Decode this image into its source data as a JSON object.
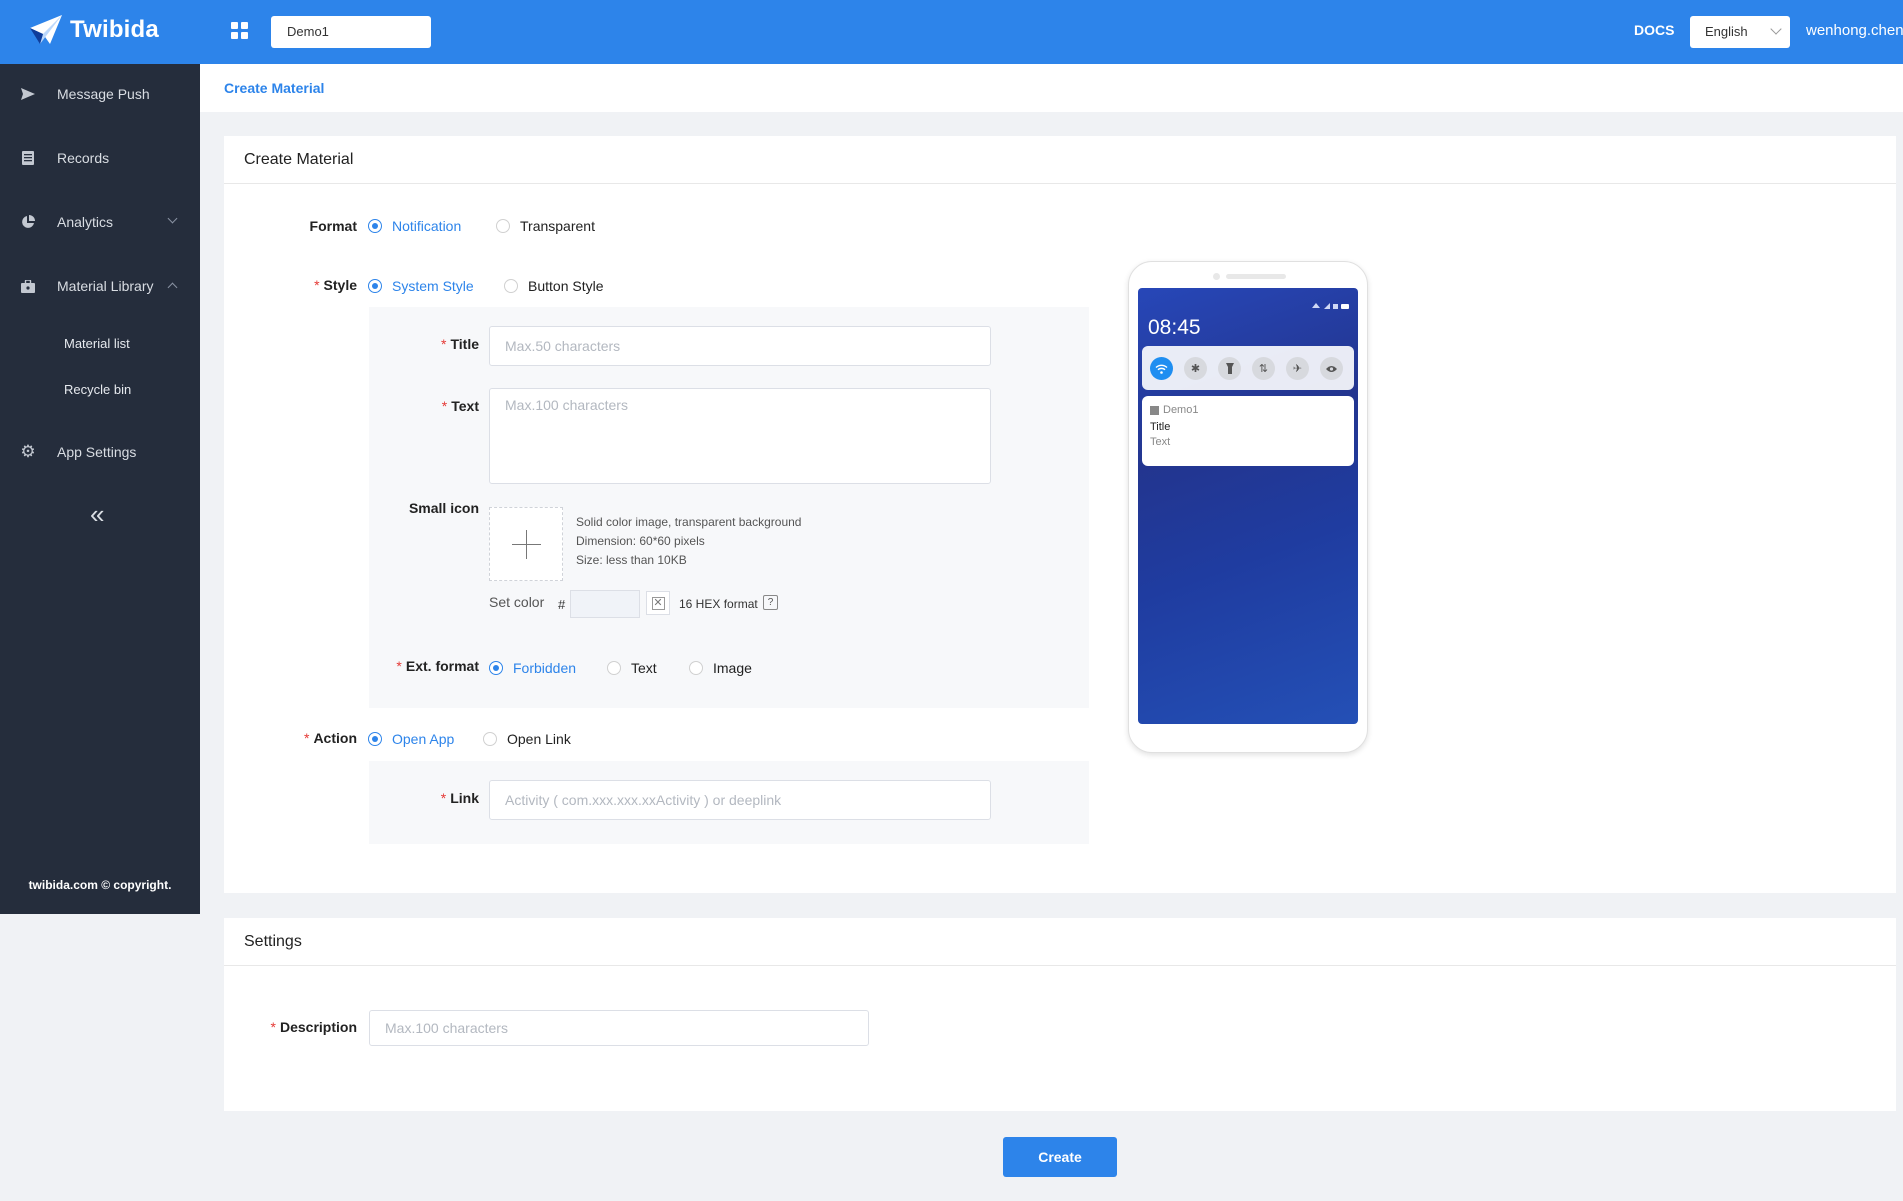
{
  "brand": {
    "name": "Twibida",
    "accent": "#2d84ea",
    "sidebar_bg": "#252d3c"
  },
  "topbar": {
    "app_selected": "Demo1",
    "docs_label": "DOCS",
    "language": "English",
    "user": "wenhong.chen"
  },
  "sidebar": {
    "items": [
      {
        "label": "Message Push",
        "icon": "send-icon"
      },
      {
        "label": "Records",
        "icon": "document-icon"
      },
      {
        "label": "Analytics",
        "icon": "pie-chart-icon"
      },
      {
        "label": "Material Library",
        "icon": "briefcase-icon"
      },
      {
        "label": "App Settings",
        "icon": "gear-icon"
      }
    ],
    "subitems": [
      "Material list",
      "Recycle bin"
    ],
    "copyright": "twibida.com © copyright."
  },
  "breadcrumb": "Create Material",
  "create_card": {
    "title": "Create Material",
    "format": {
      "label": "Format",
      "options": [
        "Notification",
        "Transparent"
      ],
      "selected": "Notification"
    },
    "style": {
      "label": "Style",
      "options": [
        "System Style",
        "Button Style"
      ],
      "selected": "System Style"
    },
    "title_field": {
      "label": "Title",
      "placeholder": "Max.50 characters"
    },
    "text_field": {
      "label": "Text",
      "placeholder": "Max.100 characters"
    },
    "small_icon": {
      "label": "Small icon",
      "hints": [
        "Solid color image, transparent background",
        "Dimension: 60*60 pixels",
        "Size: less than 10KB"
      ],
      "set_color_label": "Set color",
      "hash": "#",
      "hex_hint": "16 HEX format",
      "help": "?"
    },
    "ext_format": {
      "label": "Ext. format",
      "options": [
        "Forbidden",
        "Text",
        "Image"
      ],
      "selected": "Forbidden"
    },
    "action": {
      "label": "Action",
      "options": [
        "Open App",
        "Open Link"
      ],
      "selected": "Open App"
    },
    "link_field": {
      "label": "Link",
      "placeholder": "Activity ( com.xxx.xxx.xxActivity ) or deeplink"
    }
  },
  "preview": {
    "time": "08:45",
    "app_name": "Demo1",
    "title": "Title",
    "text": "Text"
  },
  "settings_card": {
    "title": "Settings",
    "description": {
      "label": "Description",
      "placeholder": "Max.100 characters"
    }
  },
  "create_button": "Create"
}
